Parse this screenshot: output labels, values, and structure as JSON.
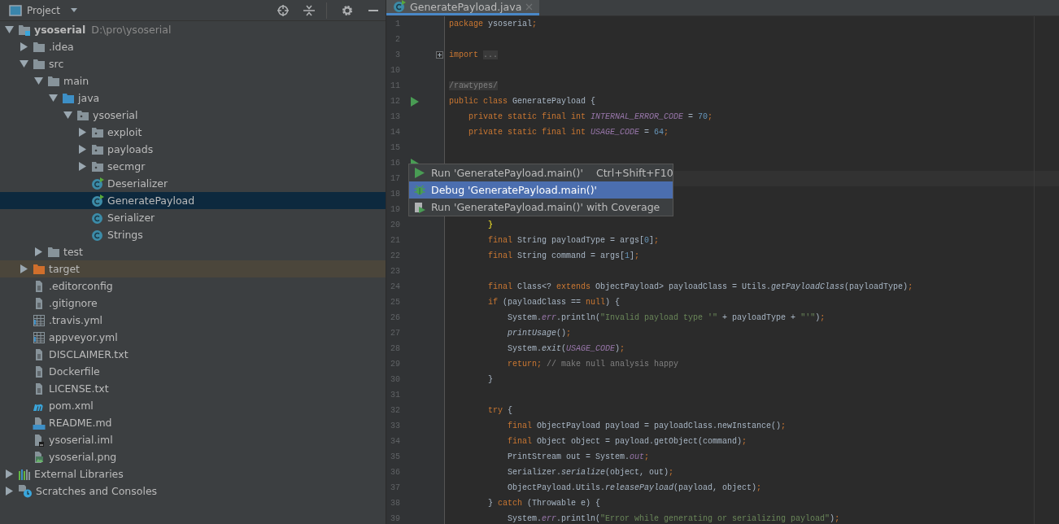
{
  "project_panel": {
    "title": "Project"
  },
  "tree": [
    {
      "label": "ysoserial",
      "path": "D:\\pro\\ysoserial",
      "kind": "module",
      "expanded": true,
      "selected": false,
      "children": [
        {
          "label": ".idea",
          "kind": "folder",
          "expanded": false,
          "selected": false
        },
        {
          "label": "src",
          "kind": "folder",
          "expanded": true,
          "selected": false,
          "children": [
            {
              "label": "main",
              "kind": "folder",
              "expanded": true,
              "selected": false,
              "children": [
                {
                  "label": "java",
                  "kind": "source",
                  "expanded": true,
                  "selected": false,
                  "children": [
                    {
                      "label": "ysoserial",
                      "kind": "package",
                      "expanded": true,
                      "selected": false,
                      "children": [
                        {
                          "label": "exploit",
                          "kind": "package",
                          "expanded": false,
                          "selected": false
                        },
                        {
                          "label": "payloads",
                          "kind": "package",
                          "expanded": false,
                          "selected": false
                        },
                        {
                          "label": "secmgr",
                          "kind": "package",
                          "expanded": false,
                          "selected": false
                        },
                        {
                          "label": "Deserializer",
                          "kind": "class-run",
                          "selected": false
                        },
                        {
                          "label": "GeneratePayload",
                          "kind": "class-run",
                          "selected": true
                        },
                        {
                          "label": "Serializer",
                          "kind": "class",
                          "selected": false
                        },
                        {
                          "label": "Strings",
                          "kind": "class",
                          "selected": false
                        }
                      ]
                    }
                  ]
                }
              ]
            },
            {
              "label": "test",
              "kind": "folder",
              "expanded": false,
              "selected": false
            }
          ]
        },
        {
          "label": "target",
          "kind": "excluded",
          "expanded": false,
          "selected": false
        },
        {
          "label": ".editorconfig",
          "kind": "text",
          "selected": false
        },
        {
          "label": ".gitignore",
          "kind": "text",
          "selected": false
        },
        {
          "label": ".travis.yml",
          "kind": "yaml",
          "selected": false
        },
        {
          "label": "appveyor.yml",
          "kind": "yaml",
          "selected": false
        },
        {
          "label": "DISCLAIMER.txt",
          "kind": "text",
          "selected": false
        },
        {
          "label": "Dockerfile",
          "kind": "text",
          "selected": false
        },
        {
          "label": "LICENSE.txt",
          "kind": "text",
          "selected": false
        },
        {
          "label": "pom.xml",
          "kind": "maven",
          "selected": false
        },
        {
          "label": "README.md",
          "kind": "markdown",
          "selected": false
        },
        {
          "label": "ysoserial.iml",
          "kind": "iml",
          "selected": false
        },
        {
          "label": "ysoserial.png",
          "kind": "image",
          "selected": false
        }
      ]
    },
    {
      "label": "External Libraries",
      "kind": "libraries",
      "expanded": false,
      "selected": false
    },
    {
      "label": "Scratches and Consoles",
      "kind": "scratches",
      "expanded": false,
      "selected": false
    }
  ],
  "tabs": [
    {
      "label": "GeneratePayload.java",
      "selected": true
    }
  ],
  "lines": [
    {
      "n": "1",
      "tokens": [
        {
          "kind": "kw",
          "text": "package "
        },
        {
          "kind": "p",
          "text": "ysoserial"
        },
        {
          "kind": "kw",
          "text": ";"
        }
      ]
    },
    {
      "n": "2"
    },
    {
      "n": "3",
      "fold": {
        "collapsed": true
      },
      "tokens": [
        {
          "kind": "kw",
          "text": "import "
        },
        {
          "kind": "fold",
          "text": "..."
        }
      ]
    },
    {
      "n": "10"
    },
    {
      "n": "11",
      "tokens": [
        {
          "kind": "anno",
          "text": "/rawtypes/"
        }
      ]
    },
    {
      "n": "12",
      "run_gutter": true,
      "tokens": [
        {
          "kind": "kw",
          "text": "public class "
        },
        {
          "kind": "p",
          "text": "GeneratePayload {"
        }
      ]
    },
    {
      "n": "13",
      "tokens": [
        {
          "kind": "kw",
          "text": "    private static final int "
        },
        {
          "kind": "const",
          "text": "INTERNAL_ERROR_CODE"
        },
        {
          "kind": "p",
          "text": " = "
        },
        {
          "kind": "num",
          "text": "70"
        },
        {
          "kind": "kw",
          "text": ";"
        }
      ]
    },
    {
      "n": "14",
      "tokens": [
        {
          "kind": "kw",
          "text": "    private static final int "
        },
        {
          "kind": "const",
          "text": "USAGE_CODE"
        },
        {
          "kind": "p",
          "text": " = "
        },
        {
          "kind": "num",
          "text": "64"
        },
        {
          "kind": "kw",
          "text": ";"
        }
      ]
    },
    {
      "n": "15"
    },
    {
      "n": "16",
      "run_gutter": true
    },
    {
      "n": "17",
      "current": true
    },
    {
      "n": "18"
    },
    {
      "n": "19"
    },
    {
      "n": "20",
      "tokens": [
        {
          "kind": "brace",
          "text": "        }"
        }
      ]
    },
    {
      "n": "21",
      "tokens": [
        {
          "kind": "kw",
          "text": "        final "
        },
        {
          "kind": "p",
          "text": "String payloadType = args["
        },
        {
          "kind": "num",
          "text": "0"
        },
        {
          "kind": "p",
          "text": "]"
        },
        {
          "kind": "kw",
          "text": ";"
        }
      ]
    },
    {
      "n": "22",
      "tokens": [
        {
          "kind": "kw",
          "text": "        final "
        },
        {
          "kind": "p",
          "text": "String command = args["
        },
        {
          "kind": "num",
          "text": "1"
        },
        {
          "kind": "p",
          "text": "]"
        },
        {
          "kind": "kw",
          "text": ";"
        }
      ]
    },
    {
      "n": "23"
    },
    {
      "n": "24",
      "tokens": [
        {
          "kind": "kw",
          "text": "        final "
        },
        {
          "kind": "p",
          "text": "Class<? "
        },
        {
          "kind": "kw",
          "text": "extends "
        },
        {
          "kind": "p",
          "text": "ObjectPayload> payloadClass = Utils."
        },
        {
          "kind": "static",
          "text": "getPayloadClass"
        },
        {
          "kind": "p",
          "text": "(payloadType)"
        },
        {
          "kind": "kw",
          "text": ";"
        }
      ]
    },
    {
      "n": "25",
      "tokens": [
        {
          "kind": "kw",
          "text": "        if "
        },
        {
          "kind": "p",
          "text": "(payloadClass == "
        },
        {
          "kind": "kw",
          "text": "null"
        },
        {
          "kind": "p",
          "text": ") {"
        }
      ]
    },
    {
      "n": "26",
      "tokens": [
        {
          "kind": "p",
          "text": "            System."
        },
        {
          "kind": "field",
          "text": "err"
        },
        {
          "kind": "p",
          "text": ".println("
        },
        {
          "kind": "str",
          "text": "\"Invalid payload type '\""
        },
        {
          "kind": "p",
          "text": " + payloadType + "
        },
        {
          "kind": "str",
          "text": "\"'\""
        },
        {
          "kind": "p",
          "text": ")"
        },
        {
          "kind": "kw",
          "text": ";"
        }
      ]
    },
    {
      "n": "27",
      "tokens": [
        {
          "kind": "static",
          "text": "            printUsage"
        },
        {
          "kind": "p",
          "text": "()"
        },
        {
          "kind": "kw",
          "text": ";"
        }
      ]
    },
    {
      "n": "28",
      "tokens": [
        {
          "kind": "p",
          "text": "            System."
        },
        {
          "kind": "static",
          "text": "exit"
        },
        {
          "kind": "p",
          "text": "("
        },
        {
          "kind": "const",
          "text": "USAGE_CODE"
        },
        {
          "kind": "p",
          "text": ")"
        },
        {
          "kind": "kw",
          "text": ";"
        }
      ]
    },
    {
      "n": "29",
      "tokens": [
        {
          "kind": "kw",
          "text": "            return; "
        },
        {
          "kind": "cmt",
          "text": "// make null analysis happy"
        }
      ]
    },
    {
      "n": "30",
      "tokens": [
        {
          "kind": "p",
          "text": "        }"
        }
      ]
    },
    {
      "n": "31"
    },
    {
      "n": "32",
      "tokens": [
        {
          "kind": "kw",
          "text": "        try "
        },
        {
          "kind": "p",
          "text": "{"
        }
      ]
    },
    {
      "n": "33",
      "tokens": [
        {
          "kind": "kw",
          "text": "            final "
        },
        {
          "kind": "p",
          "text": "ObjectPayload payload = payloadClass.newInstance()"
        },
        {
          "kind": "kw",
          "text": ";"
        }
      ]
    },
    {
      "n": "34",
      "tokens": [
        {
          "kind": "kw",
          "text": "            final "
        },
        {
          "kind": "p",
          "text": "Object object = payload.getObject(command)"
        },
        {
          "kind": "kw",
          "text": ";"
        }
      ]
    },
    {
      "n": "35",
      "tokens": [
        {
          "kind": "p",
          "text": "            PrintStream out = System."
        },
        {
          "kind": "field",
          "text": "out"
        },
        {
          "kind": "kw",
          "text": ";"
        }
      ]
    },
    {
      "n": "36",
      "tokens": [
        {
          "kind": "p",
          "text": "            Serializer."
        },
        {
          "kind": "static",
          "text": "serialize"
        },
        {
          "kind": "p",
          "text": "(object, out)"
        },
        {
          "kind": "kw",
          "text": ";"
        }
      ]
    },
    {
      "n": "37",
      "tokens": [
        {
          "kind": "p",
          "text": "            ObjectPayload.Utils."
        },
        {
          "kind": "static",
          "text": "releasePayload"
        },
        {
          "kind": "p",
          "text": "(payload, object)"
        },
        {
          "kind": "kw",
          "text": ";"
        }
      ]
    },
    {
      "n": "38",
      "tokens": [
        {
          "kind": "p",
          "text": "        } "
        },
        {
          "kind": "kw",
          "text": "catch "
        },
        {
          "kind": "p",
          "text": "(Throwable e) {"
        }
      ]
    },
    {
      "n": "39",
      "tokens": [
        {
          "kind": "p",
          "text": "            System."
        },
        {
          "kind": "field",
          "text": "err"
        },
        {
          "kind": "p",
          "text": ".println("
        },
        {
          "kind": "str",
          "text": "\"Error while generating or serializing payload\""
        },
        {
          "kind": "p",
          "text": ")"
        },
        {
          "kind": "kw",
          "text": ";"
        }
      ]
    }
  ],
  "run_menu": [
    {
      "kind": "run",
      "label": "Run 'GeneratePayload.main()'",
      "shortcut": "Ctrl+Shift+F10",
      "selected": false
    },
    {
      "kind": "debug",
      "label": "Debug 'GeneratePayload.main()'",
      "selected": true
    },
    {
      "kind": "coverage",
      "label": "Run 'GeneratePayload.main()' with Coverage",
      "selected": false
    }
  ]
}
